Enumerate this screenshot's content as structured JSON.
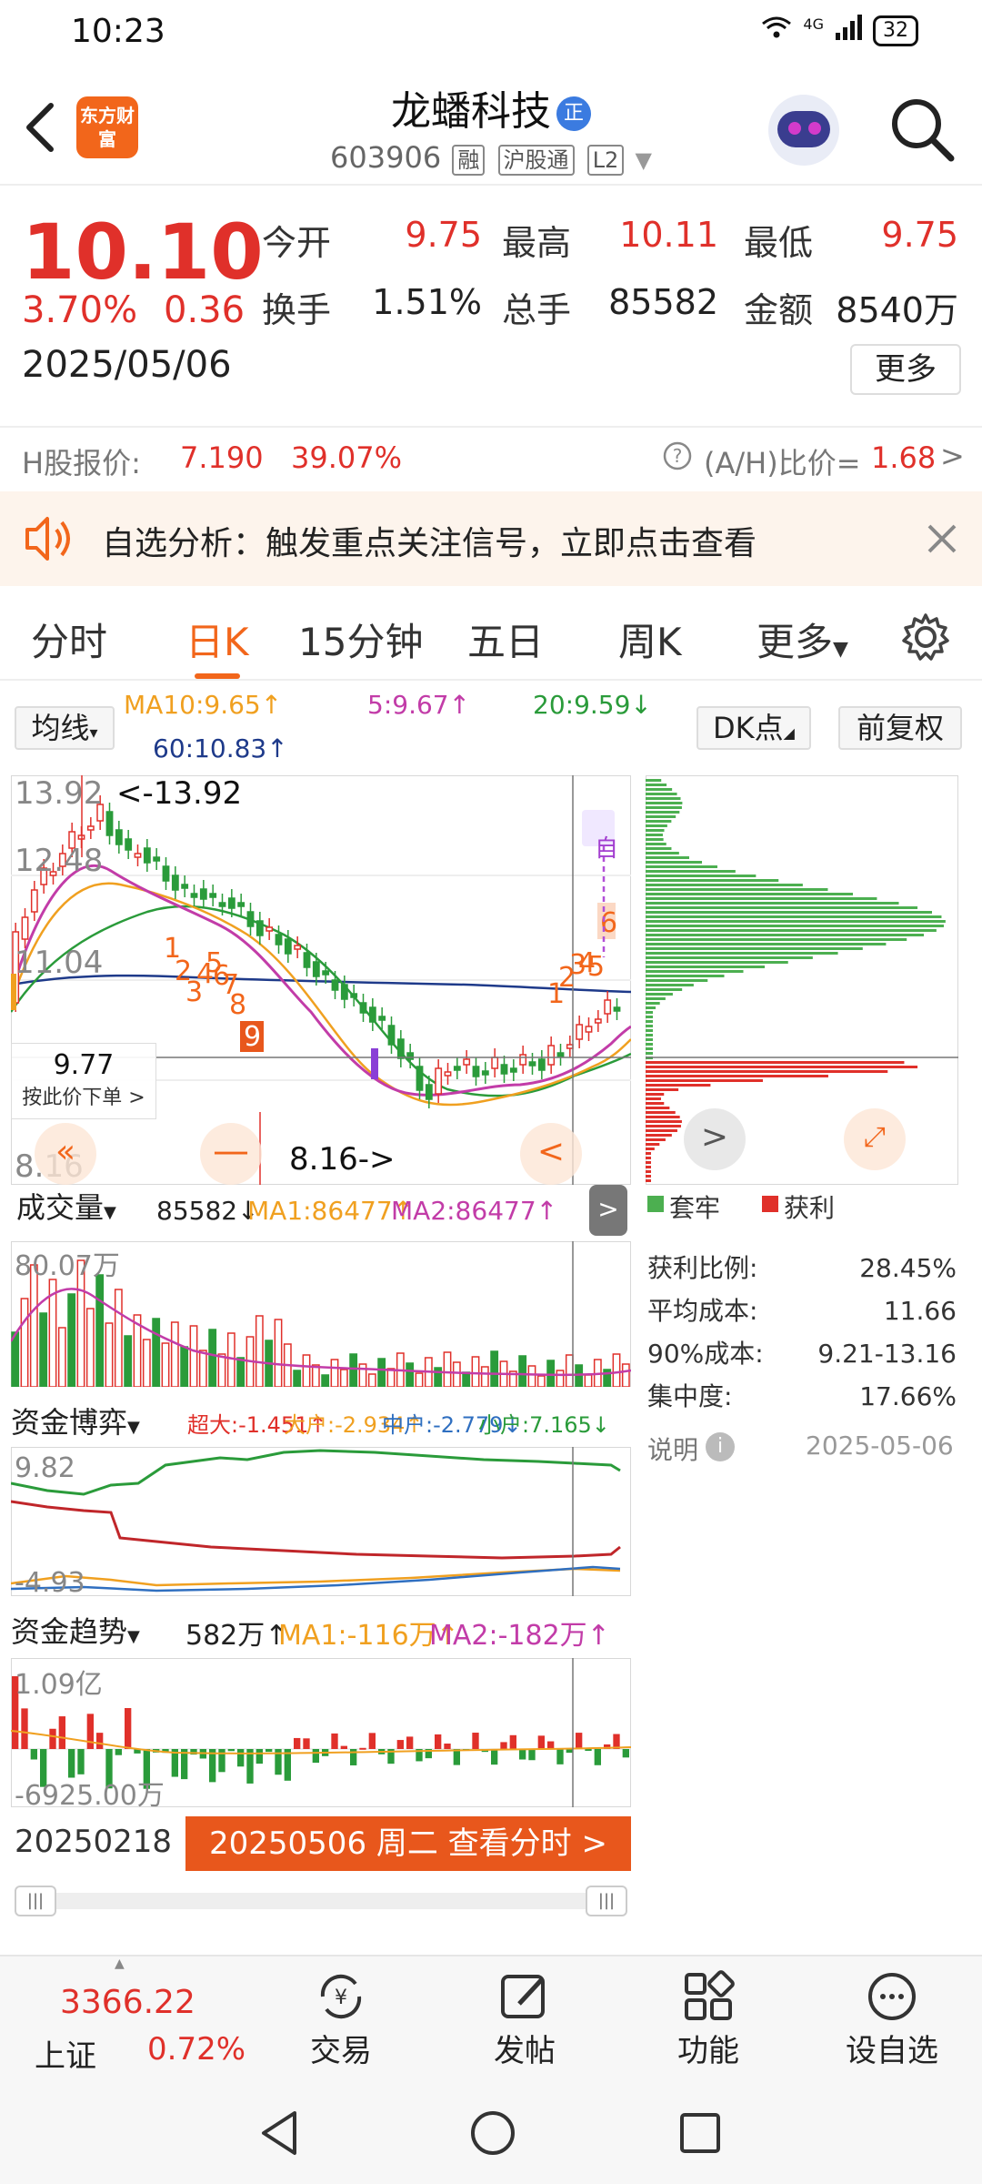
{
  "status": {
    "time": "10:23",
    "network": "4G",
    "battery": "32"
  },
  "header": {
    "logo": "东方财富",
    "title": "龙蟠科技",
    "title_badge": "正",
    "code": "603906",
    "tags": [
      "融",
      "沪股通",
      "L2"
    ]
  },
  "quote": {
    "price": "10.10",
    "change_pct": "3.70%",
    "change": "0.36",
    "date": "2025/05/06",
    "fields": [
      {
        "label": "今开",
        "value": "9.75"
      },
      {
        "label": "最高",
        "value": "10.11"
      },
      {
        "label": "最低",
        "value": "9.75"
      },
      {
        "label": "换手",
        "value": "1.51%"
      },
      {
        "label": "总手",
        "value": "85582"
      },
      {
        "label": "金额",
        "value": "8540万"
      }
    ],
    "more": "更多",
    "h_label": "H股报价:",
    "h_price": "7.190",
    "h_pct": "39.07%",
    "ah_label": "(A/H)比价=",
    "ah_value": "1.68"
  },
  "alert": {
    "text": "自选分析：触发重点关注信号，立即点击查看"
  },
  "tabs": [
    "分时",
    "日K",
    "15分钟",
    "五日",
    "周K",
    "更多"
  ],
  "kline": {
    "ma_button": "均线",
    "ma10": "MA10:9.65↑",
    "ma5": "5:9.67↑",
    "ma20": "20:9.59↓",
    "ma60": "60:10.83↑",
    "dk_button": "DK点",
    "fq_button": "前复权",
    "y_top": "13.92",
    "y_2": "12.48",
    "y_3": "11.04",
    "y_bottom": "8.16",
    "max_mark": "<-13.92",
    "min_mark": "8.16->",
    "cursor_price": "9.77",
    "cursor_hint": "按此价下单",
    "auto_tag": "自"
  },
  "chip": {
    "legend_trapped": "套牢",
    "legend_profit": "获利",
    "rows": [
      {
        "label": "获利比例:",
        "value": "28.45%"
      },
      {
        "label": "平均成本:",
        "value": "11.66"
      },
      {
        "label": "90%成本:",
        "value": "9.21-13.16"
      },
      {
        "label": "集中度:",
        "value": "17.66%"
      }
    ],
    "note": "说明",
    "date": "2025-05-06"
  },
  "volume": {
    "title": "成交量",
    "val": "85582↓",
    "ma1": "MA1:86477↑",
    "ma2": "MA2:86477↑",
    "ymax": "80.07万"
  },
  "fund_game": {
    "title": "资金博弈",
    "super": "超大:-1.451↑",
    "big": "大户:-2.934↑",
    "mid": "中户:-2.779↓",
    "small": "小户:7.165↓",
    "ymax": "9.82",
    "ymin": "-4.93"
  },
  "fund_trend": {
    "title": "资金趋势",
    "val": "582万↑",
    "ma1": "MA1:-116万↑",
    "ma2": "MA2:-182万↑",
    "ymax": "1.09亿",
    "ymin": "-6925.00万"
  },
  "footer_chart": {
    "start_date": "20250218",
    "cursor_label": "20250506 周二 查看分时 >"
  },
  "bottom": {
    "index_price": "3366.22",
    "index_name": "上证",
    "index_pct": "0.72%",
    "items": [
      "交易",
      "发帖",
      "功能",
      "设自选"
    ]
  },
  "colors": {
    "up": "#e0302a",
    "down": "#2a9b3a",
    "accent": "#f2661b",
    "ma5": "#c23ca8",
    "ma10": "#f0a020",
    "ma20": "#2a9b3a",
    "ma60": "#1e3a8a"
  }
}
